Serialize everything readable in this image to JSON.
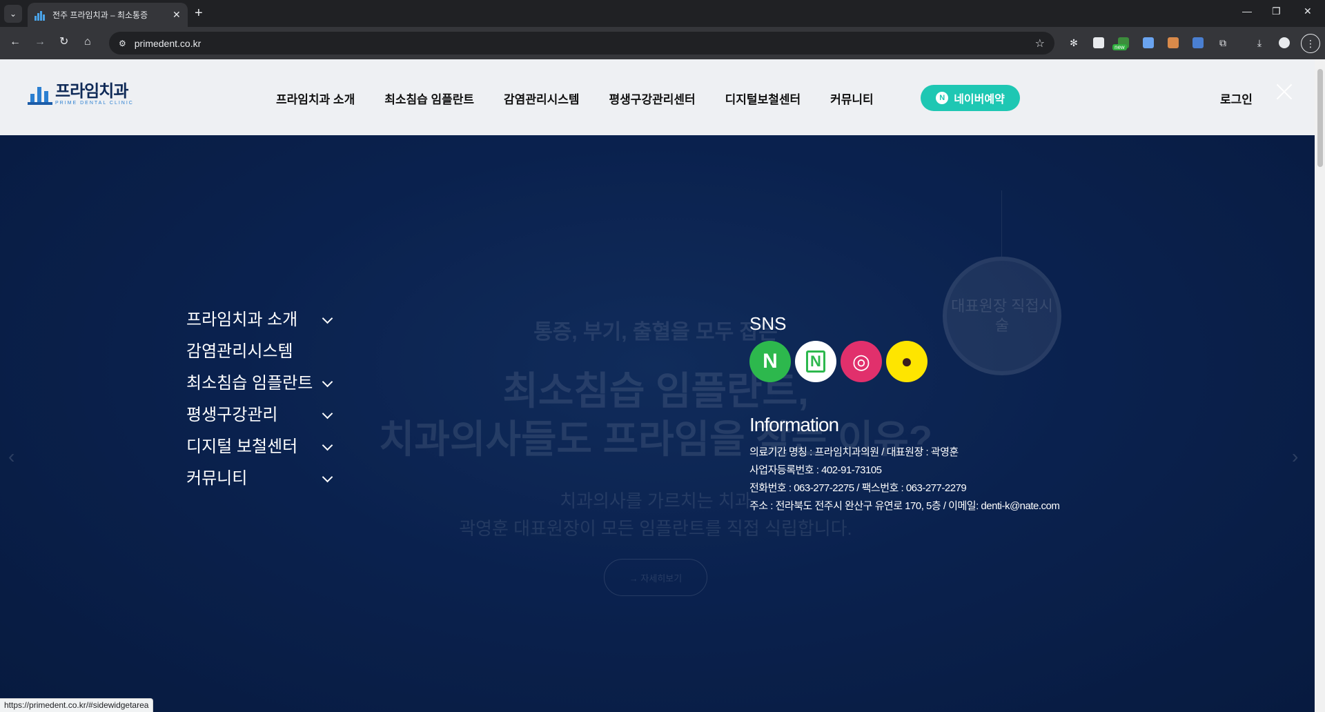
{
  "browser": {
    "tab_title": "전주 프라임치과 – 최소통증 ",
    "url": "primedent.co.kr",
    "new_badge": "new",
    "status_url": "https://primedent.co.kr/#sidewidgetarea"
  },
  "header": {
    "logo_kor": "프라임치과",
    "logo_eng": "PRIME DENTAL CLINIC",
    "nav": [
      "프라임치과 소개",
      "최소침습 임플란트",
      "감염관리시스템",
      "평생구강관리센터",
      "디지털보철센터",
      "커뮤니티"
    ],
    "naver_label": "네이버예약",
    "naver_icon_letter": "N",
    "login": "로그인"
  },
  "hero": {
    "sub": "통증, 부기, 출혈을 모두 잡은",
    "title_line1": "최소침습 임플란트,",
    "title_line2": "치과의사들도 프라임을 찾는 이유?",
    "desc_line1": "치과의사를 가르치는 치과",
    "desc_line2": "곽영훈 대표원장이 모든 임플란트를 직접 식립합니다.",
    "button": "→ 자세히보기",
    "badge": "대표원장 직접시술"
  },
  "side_menu": {
    "items": [
      {
        "label": "프라임치과 소개",
        "has_children": true
      },
      {
        "label": "감염관리시스템",
        "has_children": false
      },
      {
        "label": "최소침습 임플란트",
        "has_children": true
      },
      {
        "label": "평생구강관리",
        "has_children": true
      },
      {
        "label": "디지털 보철센터",
        "has_children": true
      },
      {
        "label": "커뮤니티",
        "has_children": true
      }
    ]
  },
  "sns": {
    "title": "SNS",
    "buttons": [
      {
        "name": "naver-blog",
        "letter": "N",
        "bg": "#2db84d",
        "fg": "#ffffff"
      },
      {
        "name": "naver-booking",
        "letter": "N",
        "bg": "#ffffff",
        "fg": "#2db84d"
      },
      {
        "name": "instagram",
        "letter": "◎",
        "bg": "#e1306c",
        "fg": "#ffffff"
      },
      {
        "name": "kakao",
        "letter": "●",
        "bg": "#fee500",
        "fg": "#3a1d1d"
      }
    ]
  },
  "info": {
    "title": "Information",
    "lines": [
      "의료기간 명칭 : 프라임치과의원 / 대표원장 : 곽영훈",
      "사업자등록번호 : 402-91-73105",
      "전화번호 : 063-277-2275 / 팩스번호 : 063-277-2279",
      "주소 : 전라북도 전주시 완산구 유연로 170, 5층 / 이메일: denti-k@nate.com"
    ]
  },
  "colors": {
    "accent": "#1ec7b3",
    "overlay": "#0d2b66",
    "header_bg": "#eef0f3"
  }
}
